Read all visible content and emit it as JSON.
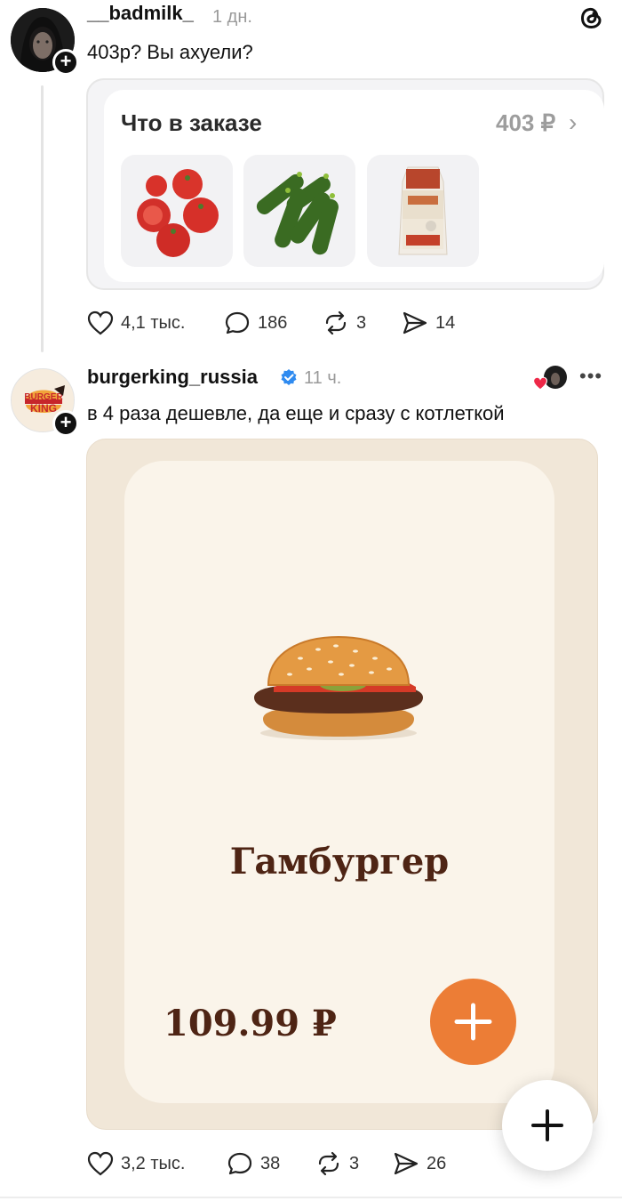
{
  "app": {
    "logo_icon": "threads-logo-icon"
  },
  "posts": [
    {
      "username": "__badmilk_",
      "time": "1 дн.",
      "text": "403р? Вы ахуели?",
      "order_card": {
        "title": "Что в заказе",
        "price": "403 ₽",
        "items": [
          "tomatoes-image",
          "cucumbers-image",
          "bread-image"
        ]
      },
      "actions": {
        "likes": "4,1 тыс.",
        "comments": "186",
        "reposts": "3",
        "shares": "14"
      }
    },
    {
      "username": "burgerking_russia",
      "verified": true,
      "time": "11 ч.",
      "text": "в 4 раза дешевле, да еще и сразу с котлеткой",
      "promo": {
        "product_name": "Гамбургер",
        "price": "109.99 ₽",
        "accent_color": "#ec7d36",
        "text_color": "#4e2414"
      },
      "actions": {
        "likes": "3,2 тыс.",
        "comments": "38",
        "reposts": "3",
        "shares": "26"
      }
    }
  ],
  "fab": {
    "icon": "plus-icon"
  }
}
